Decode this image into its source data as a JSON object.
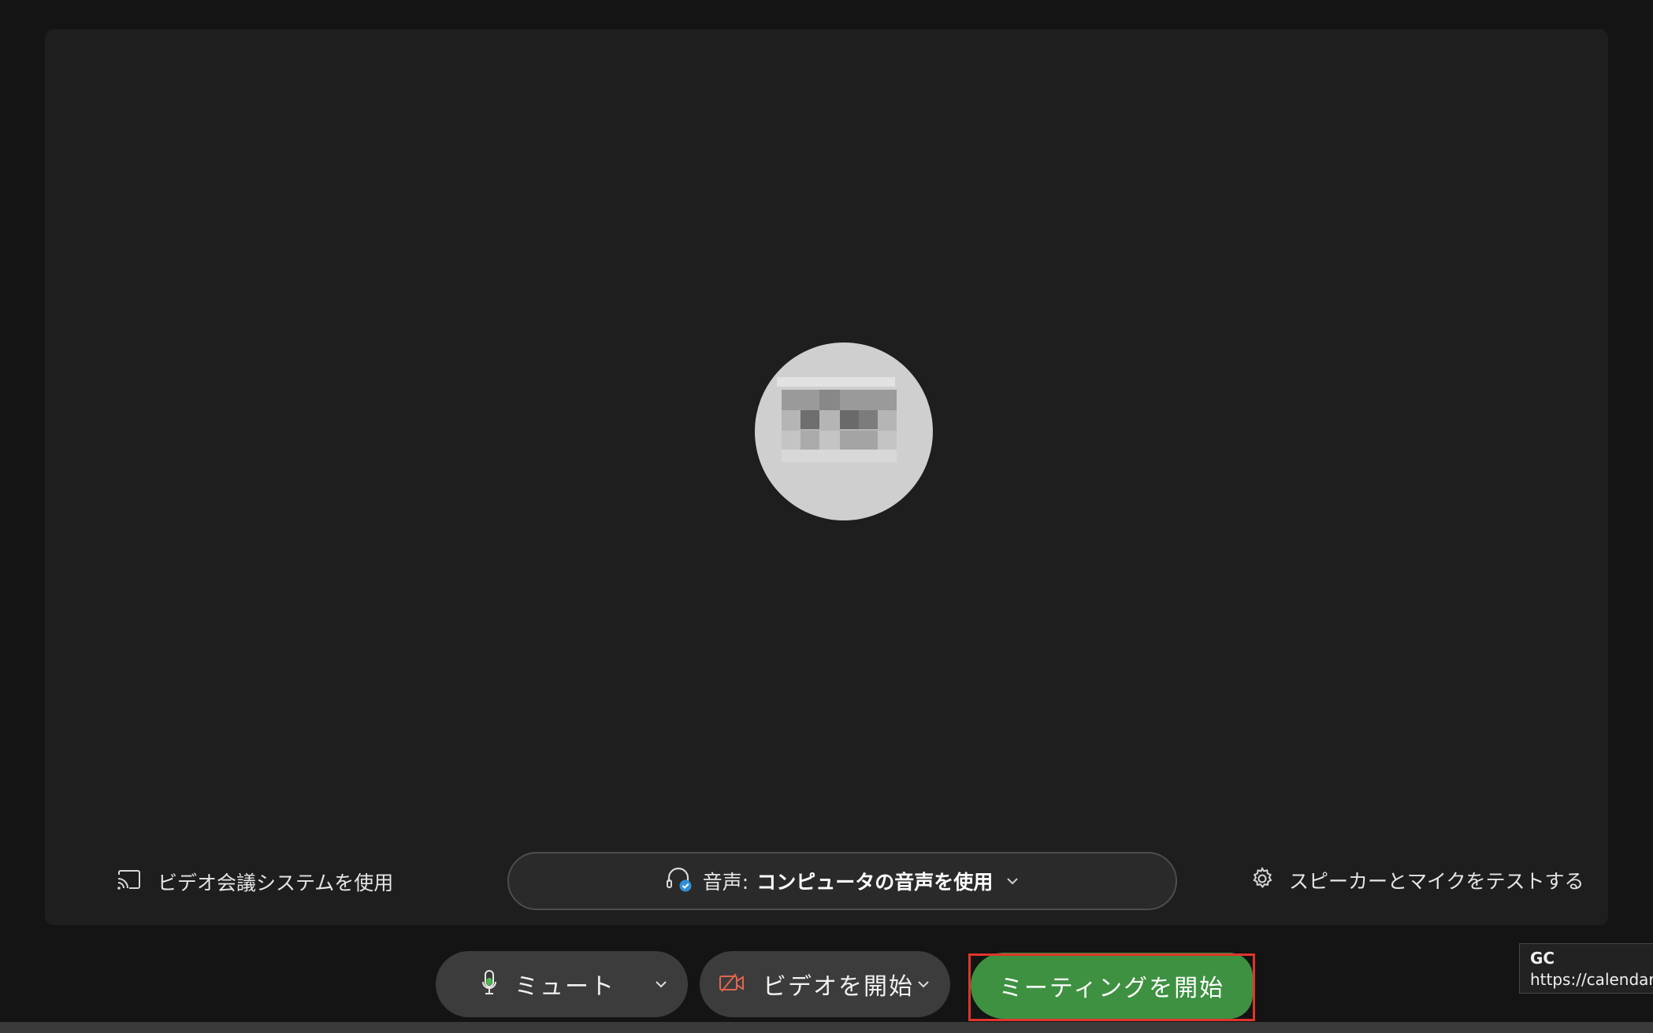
{
  "stage": {
    "room_system_label": "ビデオ会議システムを使用",
    "audio": {
      "prefix": "音声:",
      "value": "コンピュータの音声を使用"
    },
    "test_audio_label": "スピーカーとマイクをテストする"
  },
  "controls": {
    "mute_label": "ミュート",
    "video_label": "ビデオを開始",
    "start_meeting_label": "ミーティングを開始"
  },
  "tooltip": {
    "line1": "GC",
    "line2": "https://calendar."
  },
  "colors": {
    "background": "#141414",
    "stage": "#1e1e1e",
    "start_button": "#3e9141",
    "highlight_box": "#e0352b",
    "video_icon": "#e0664f",
    "audio_badge": "#2f8fd8"
  },
  "icons": {
    "room_system": "cast-screen-icon",
    "audio": "headset-icon",
    "test_audio": "gear-icon",
    "mute": "microphone-icon",
    "video": "video-camera-off-icon",
    "dropdown": "chevron-down-icon"
  }
}
